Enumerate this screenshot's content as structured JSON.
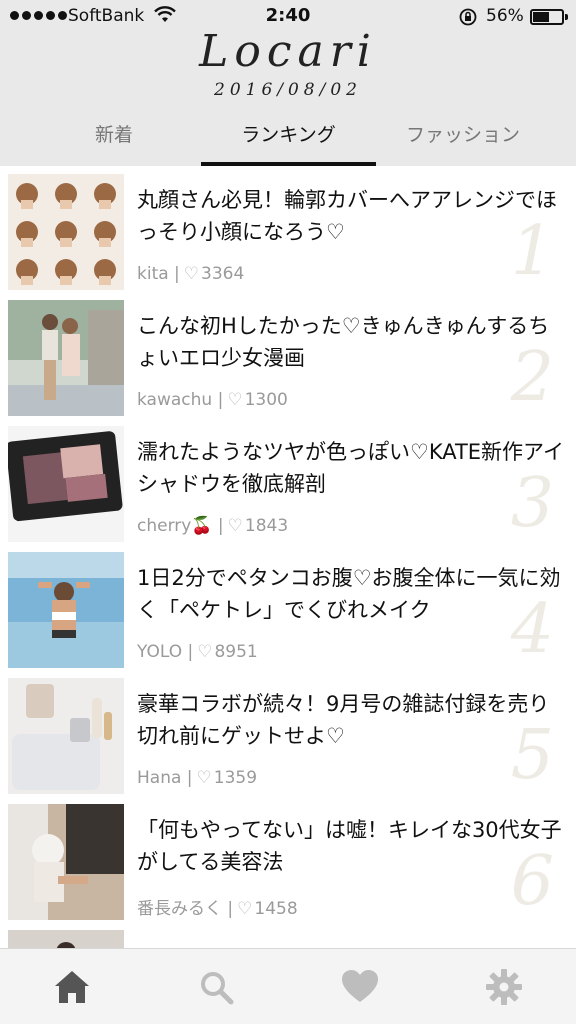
{
  "status_bar": {
    "carrier": "SoftBank",
    "time": "2:40",
    "battery_percent_label": "56%",
    "battery_level": 0.56,
    "signal_dots": 5,
    "icons": [
      "wifi-icon",
      "orientation-lock-icon",
      "battery-icon"
    ]
  },
  "header": {
    "logo": "Locari",
    "date": "2016/08/02"
  },
  "tabs": [
    {
      "label": "新着",
      "active": false
    },
    {
      "label": "ランキング",
      "active": true
    },
    {
      "label": "ファッション",
      "active": false
    }
  ],
  "articles": [
    {
      "rank": "1",
      "title": "丸顔さん必見！輪郭カバーへアアレンジでほっそり小顔になろう♡",
      "author": "kita",
      "likes": "3364"
    },
    {
      "rank": "2",
      "title": "こんな初Hしたかった♡きゅんきゅんするちょいエロ少女漫画",
      "author": "kawachu",
      "likes": "1300"
    },
    {
      "rank": "3",
      "title": "濡れたようなツヤが色っぽい♡KATE新作アイシャドウを徹底解剖",
      "author": "cherry🍒",
      "likes": "1843"
    },
    {
      "rank": "4",
      "title": "1日2分でペタンコお腹♡お腹全体に一気に効く「ペケトレ」でくびれメイク",
      "author": "YOLO",
      "likes": "8951"
    },
    {
      "rank": "5",
      "title": "豪華コラボが続々！9月号の雑誌付録を売り切れ前にゲットせよ♡",
      "author": "Hana",
      "likes": "1359"
    },
    {
      "rank": "6",
      "title": "「何もやってない」は嘘！キレイな30代女子がしてる美容法",
      "author": "番長みるく",
      "likes": "1458"
    }
  ],
  "bottom_tabs": [
    {
      "icon": "home-icon",
      "active": true
    },
    {
      "icon": "search-icon",
      "active": false
    },
    {
      "icon": "heart-icon",
      "active": false
    },
    {
      "icon": "gear-icon",
      "active": false
    }
  ],
  "colors": {
    "header_bg": "#e9e9e9",
    "rank_number": "#eeebe4",
    "meta_text": "#9a9a9a",
    "tabbar_icon": "#bdbdbd",
    "tabbar_icon_active": "#555555"
  }
}
